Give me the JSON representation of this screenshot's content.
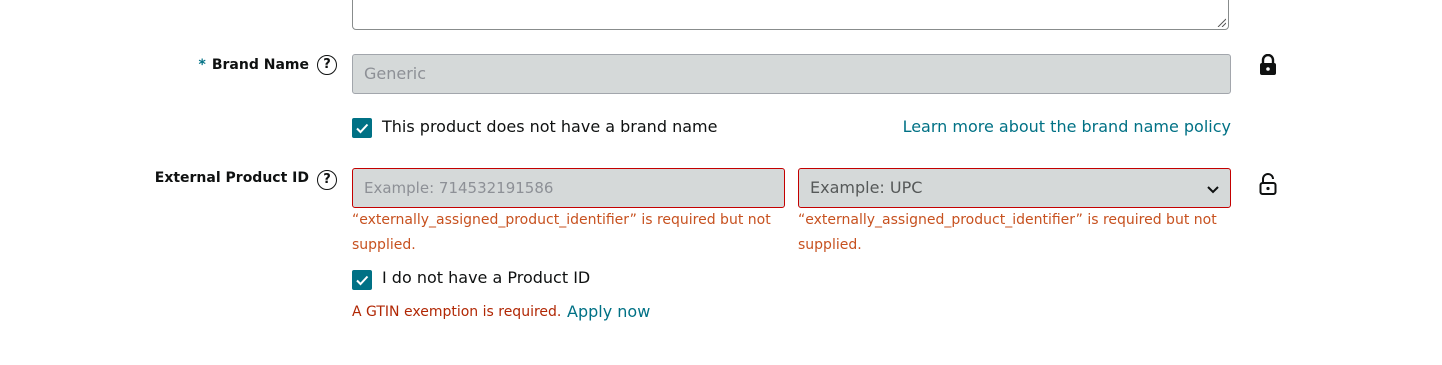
{
  "brand": {
    "required_marker": "*",
    "label": "Brand Name",
    "help_glyph": "?",
    "value": "Generic",
    "lock_icon": "lock-closed-icon",
    "no_brand_checkbox": {
      "checked": true,
      "label": "This product does not have a brand name"
    },
    "policy_link": "Learn more about the brand name policy"
  },
  "external_id": {
    "label": "External Product ID",
    "help_glyph": "?",
    "id_placeholder": "Example: 714532191586",
    "type_selected": "Example: UPC",
    "id_error": "“externally_assigned_product_identifier” is required but not supplied.",
    "type_error": "“externally_assigned_product_identifier” is required but not supplied.",
    "lock_icon": "lock-open-icon",
    "no_id_checkbox": {
      "checked": true,
      "label": "I do not have a Product ID"
    },
    "gtin_message": "A GTIN exemption is required.",
    "apply_link": "Apply now"
  },
  "colors": {
    "accent": "#007185",
    "error": "#c7511f",
    "error_border": "#c40000",
    "disabled_bg": "#d5d9d9"
  }
}
